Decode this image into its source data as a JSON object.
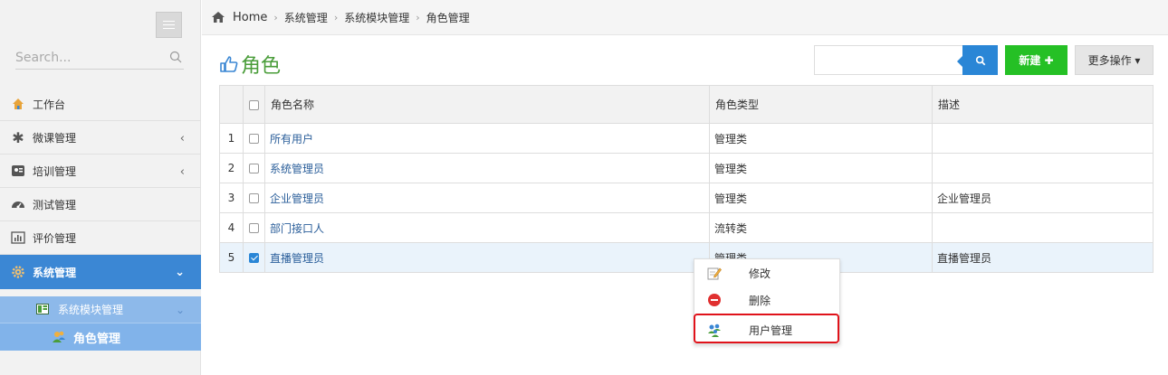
{
  "sidebar": {
    "search_placeholder": "Search...",
    "items": [
      {
        "label": "工作台"
      },
      {
        "label": "微课管理"
      },
      {
        "label": "培训管理"
      },
      {
        "label": "测试管理"
      },
      {
        "label": "评价管理"
      },
      {
        "label": "系统管理"
      }
    ],
    "submenu": {
      "module_label": "系统模块管理",
      "role_label": "角色管理"
    }
  },
  "breadcrumb": {
    "home": "Home",
    "items": [
      "系统管理",
      "系统模块管理",
      "角色管理"
    ]
  },
  "page": {
    "title": "角色"
  },
  "toolbar": {
    "search_value": "",
    "new_label": "新建 ✚",
    "more_label": "更多操作 ▾"
  },
  "table": {
    "columns": [
      "角色名称",
      "角色类型",
      "描述"
    ],
    "rows": [
      {
        "index": "1",
        "name": "所有用户",
        "type": "管理类",
        "desc": "",
        "checked": false
      },
      {
        "index": "2",
        "name": "系统管理员",
        "type": "管理类",
        "desc": "",
        "checked": false
      },
      {
        "index": "3",
        "name": "企业管理员",
        "type": "管理类",
        "desc": "企业管理员",
        "checked": false
      },
      {
        "index": "4",
        "name": "部门接口人",
        "type": "流转类",
        "desc": "",
        "checked": false
      },
      {
        "index": "5",
        "name": "直播管理员",
        "type": "管理类",
        "desc": "直播管理员",
        "checked": true
      }
    ]
  },
  "context_menu": {
    "items": [
      "修改",
      "删除",
      "用户管理"
    ]
  },
  "colors": {
    "active_nav": "#3b87d4",
    "submenu": "#8db9ea",
    "title_green": "#4a9d3a",
    "new_button": "#25c025",
    "search_button": "#2a86d6",
    "highlight_red": "#e0121a"
  }
}
